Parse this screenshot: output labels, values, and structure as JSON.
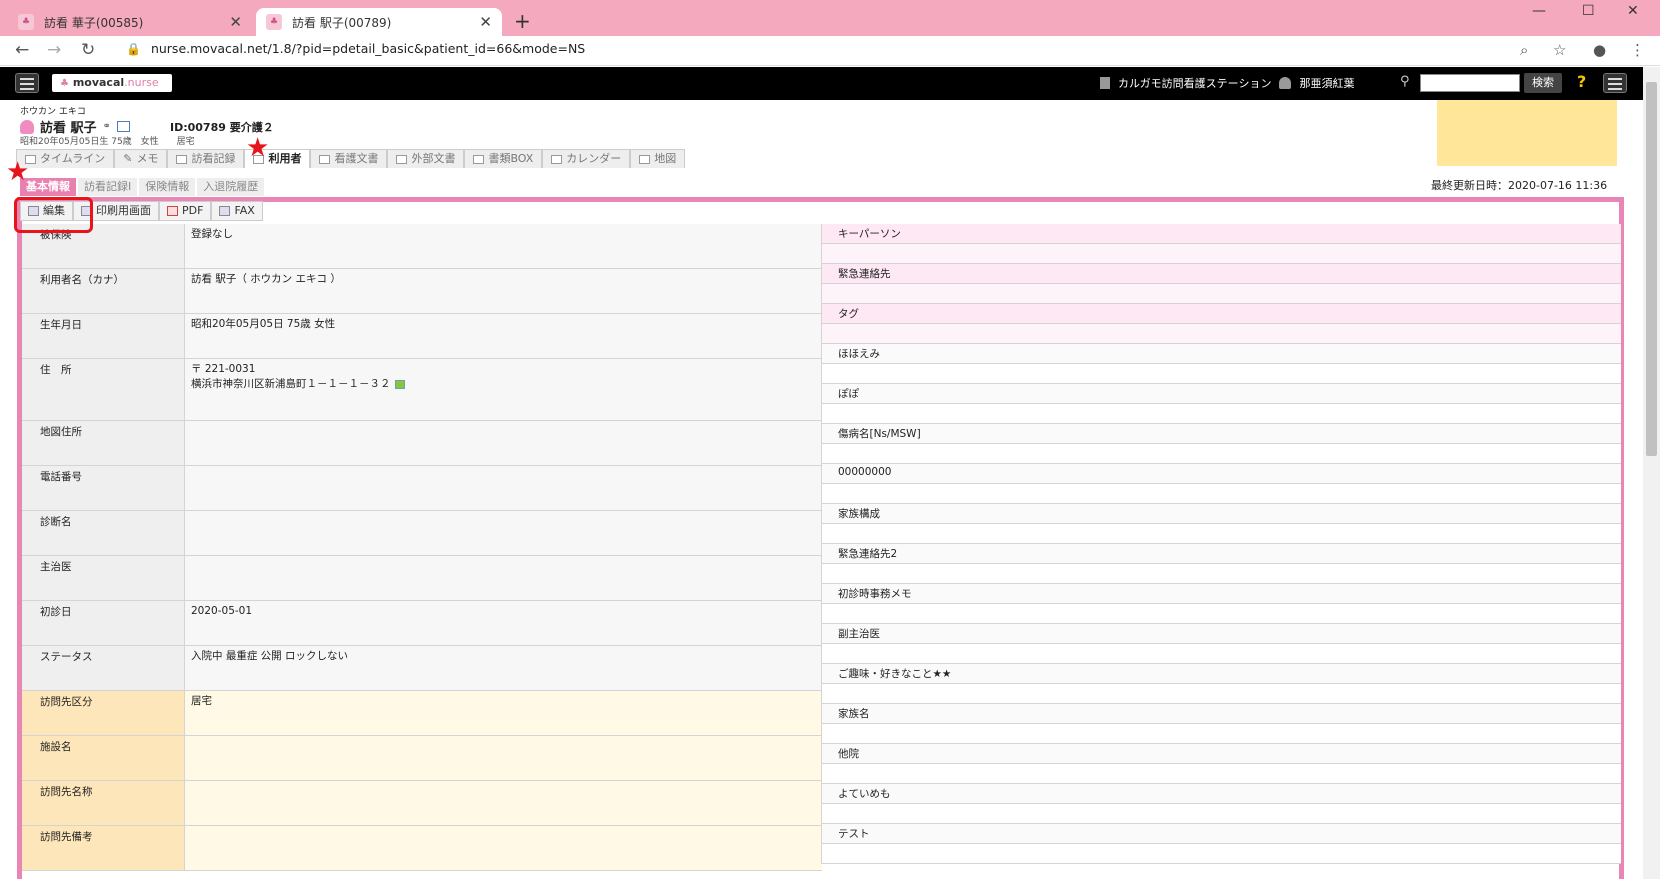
{
  "browser": {
    "tabs": [
      {
        "title": "訪看 華子(00585)",
        "active": false
      },
      {
        "title": "訪看 駅子(00789)",
        "active": true
      }
    ],
    "url": "nurse.movacal.net/1.8/?pid=pdetail_basic&patient_id=66&mode=NS"
  },
  "header": {
    "logo": "movacal",
    "logo_suffix": ".nurse",
    "station": "カルガモ訪問看護ステーション",
    "user": "那亜須紅葉",
    "search_button": "検索",
    "help": "?"
  },
  "patient": {
    "kana": "ホウカン エキコ",
    "name": "訪看 駅子",
    "id": "ID:00789 要介護２",
    "meta": "昭和20年05月05日生 75歳　女性　　居宅"
  },
  "main_tabs": [
    "タイムライン",
    "メモ",
    "訪看記録",
    "利用者",
    "看護文書",
    "外部文書",
    "書類BOX",
    "カレンダー",
    "地図"
  ],
  "sub_tabs": [
    "基本情報",
    "訪看記録I",
    "保険情報",
    "入退院履歴"
  ],
  "last_updated": "最終更新日時：2020-07-16 11:36",
  "actions": [
    "編集",
    "印刷用画面",
    "PDF",
    "FAX"
  ],
  "left_rows": [
    {
      "label": "被保険",
      "value": "登録なし"
    },
    {
      "label": "利用者名（カナ）",
      "value": "訪看 駅子（ ホウカン エキコ ）"
    },
    {
      "label": "生年月日",
      "value": "昭和20年05月05日 75歳 女性"
    },
    {
      "label": "住　所",
      "value": "〒 221-0031",
      "value2": "横浜市神奈川区新浦島町１－１－１－３２"
    },
    {
      "label": "地図住所",
      "value": ""
    },
    {
      "label": "電話番号",
      "value": ""
    },
    {
      "label": "診断名",
      "value": ""
    },
    {
      "label": "主治医",
      "value": ""
    },
    {
      "label": "初診日",
      "value": "2020-05-01"
    },
    {
      "label": "ステータス",
      "value": "入院中 最重症 公開 ロックしない"
    },
    {
      "label": "訪問先区分",
      "value": "居宅"
    },
    {
      "label": "施設名",
      "value": ""
    },
    {
      "label": "訪問先名称",
      "value": ""
    },
    {
      "label": "訪問先備考",
      "value": ""
    }
  ],
  "right_rows": [
    "キーパーソン",
    "緊急連絡先",
    "タグ",
    "ほほえみ",
    "ぽぽ",
    "傷病名[Ns/MSW]",
    "00000000",
    "家族構成",
    "緊急連絡先2",
    "初診時事務メモ",
    "副主治医",
    "ご趣味・好きなこと★★",
    "家族名",
    "他院",
    "よていめも",
    "テスト"
  ]
}
